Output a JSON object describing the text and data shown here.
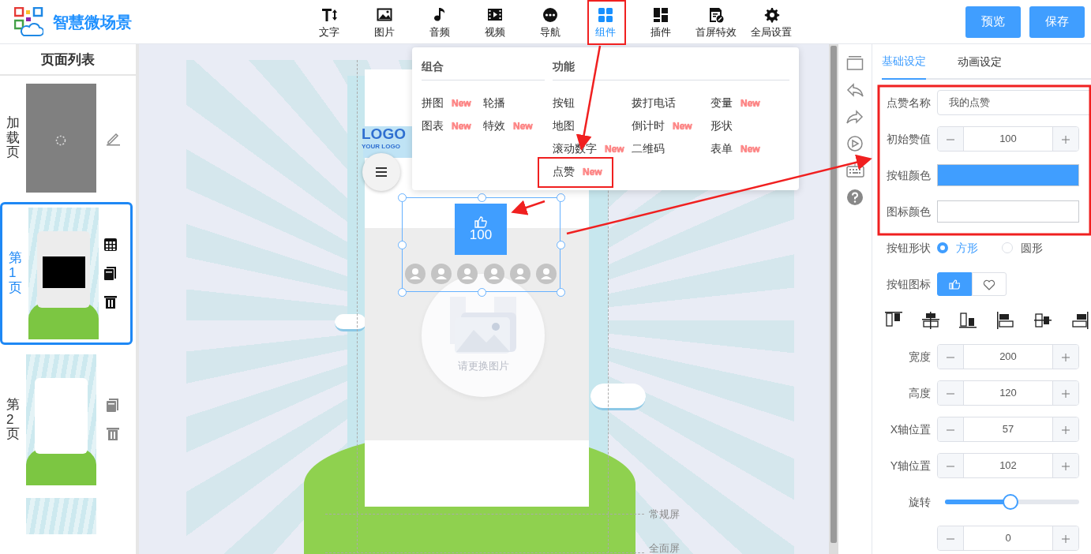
{
  "app": {
    "title": "智慧微场景"
  },
  "toolbar": [
    {
      "label": "文字",
      "selected": false
    },
    {
      "label": "图片",
      "selected": false
    },
    {
      "label": "音频",
      "selected": false
    },
    {
      "label": "视频",
      "selected": false
    },
    {
      "label": "导航",
      "selected": false
    },
    {
      "label": "组件",
      "selected": true
    },
    {
      "label": "插件",
      "selected": false
    },
    {
      "label": "首屏特效",
      "selected": false
    },
    {
      "label": "全局设置",
      "selected": false
    }
  ],
  "actions": [
    {
      "label": "预览"
    },
    {
      "label": "保存"
    }
  ],
  "pages": {
    "title": "页面列表",
    "items": [
      {
        "kind": "loading",
        "label": "加载页",
        "selected": false
      },
      {
        "kind": "page",
        "label": "第1页",
        "selected": true
      },
      {
        "kind": "page",
        "label": "第2页",
        "selected": false
      },
      {
        "kind": "page",
        "selected": false
      }
    ]
  },
  "components_menu": {
    "groups": [
      {
        "title": "组合",
        "rows": [
          [
            {
              "label": "拼图",
              "badge": "New"
            },
            {
              "label": "轮播"
            }
          ],
          [
            {
              "label": "图表",
              "badge": "New"
            },
            {
              "label": "特效",
              "badge": "New"
            }
          ]
        ]
      },
      {
        "title": "功能",
        "rows": [
          [
            {
              "label": "按钮"
            },
            {
              "label": "拨打电话"
            },
            {
              "label": "变量",
              "badge": "New"
            }
          ],
          [
            {
              "label": "地图"
            },
            {
              "label": "倒计时",
              "badge": "New"
            },
            {
              "label": "形状"
            }
          ],
          [
            {
              "label": "滚动数字",
              "badge": "New"
            },
            {
              "label": "二维码"
            },
            {
              "label": "表单",
              "badge": "New"
            }
          ],
          [
            {
              "label": "点赞",
              "badge": "New"
            }
          ]
        ]
      }
    ]
  },
  "canvas": {
    "logo": "LOGO",
    "logo_tagline": "YOUR LOGO",
    "like_count": "100",
    "image_placeholder": "请更换图片",
    "guides": [
      "常规屏",
      "全面屏"
    ]
  },
  "settings": {
    "tabs": [
      {
        "label": "基础设定",
        "selected": true
      },
      {
        "label": "动画设定",
        "selected": false
      }
    ],
    "fields": [
      {
        "kind": "text",
        "label": "点赞名称",
        "value": "我的点赞"
      },
      {
        "kind": "stepper",
        "label": "初始赞值",
        "value": "100"
      },
      {
        "kind": "color",
        "label": "按钮颜色",
        "color": "#409eff"
      },
      {
        "kind": "color",
        "label": "图标颜色",
        "color": "#ffffff"
      },
      {
        "kind": "radio",
        "label": "按钮形状",
        "options": [
          {
            "label": "方形",
            "selected": true
          },
          {
            "label": "圆形",
            "selected": false
          }
        ]
      },
      {
        "kind": "icons",
        "label": "按钮图标",
        "options": [
          {
            "selected": true
          },
          {
            "selected": false
          }
        ]
      },
      {
        "kind": "align"
      },
      {
        "kind": "stepper",
        "label": "宽度",
        "value": "200"
      },
      {
        "kind": "stepper",
        "label": "高度",
        "value": "120"
      },
      {
        "kind": "stepper",
        "label": "X轴位置",
        "value": "57"
      },
      {
        "kind": "stepper",
        "label": "Y轴位置",
        "value": "102"
      },
      {
        "kind": "slider",
        "label": "旋转",
        "level": 0.49
      },
      {
        "kind": "stepper",
        "value": "0"
      }
    ]
  }
}
